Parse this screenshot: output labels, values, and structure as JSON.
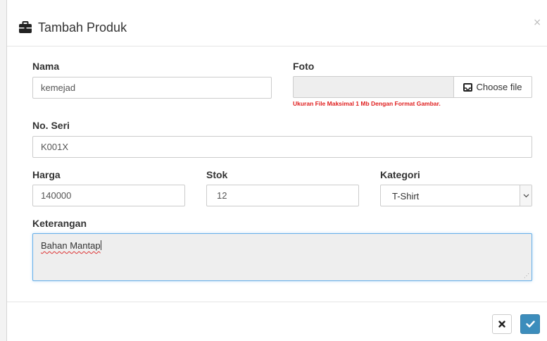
{
  "dialog": {
    "title": "Tambah Produk",
    "close_symbol": "×"
  },
  "form": {
    "nama": {
      "label": "Nama",
      "value": "kemejad"
    },
    "foto": {
      "label": "Foto",
      "value": "",
      "button_label": "Choose file",
      "hint": "Ukuran File Maksimal 1 Mb Dengan Format Gambar."
    },
    "no_seri": {
      "label": "No. Seri",
      "value": "K001X"
    },
    "harga": {
      "label": "Harga",
      "value": "140000"
    },
    "stok": {
      "label": "Stok",
      "value": "12"
    },
    "kategori": {
      "label": "Kategori",
      "value": "T-Shirt"
    },
    "keterangan": {
      "label": "Keterangan",
      "value": "Bahan Mantap"
    }
  },
  "footer": {
    "cancel_icon": "times-icon",
    "submit_icon": "check-icon"
  },
  "colors": {
    "primary_button": "#3c8dbc",
    "hint_text": "#e02020",
    "focus_border": "#66afe9"
  }
}
